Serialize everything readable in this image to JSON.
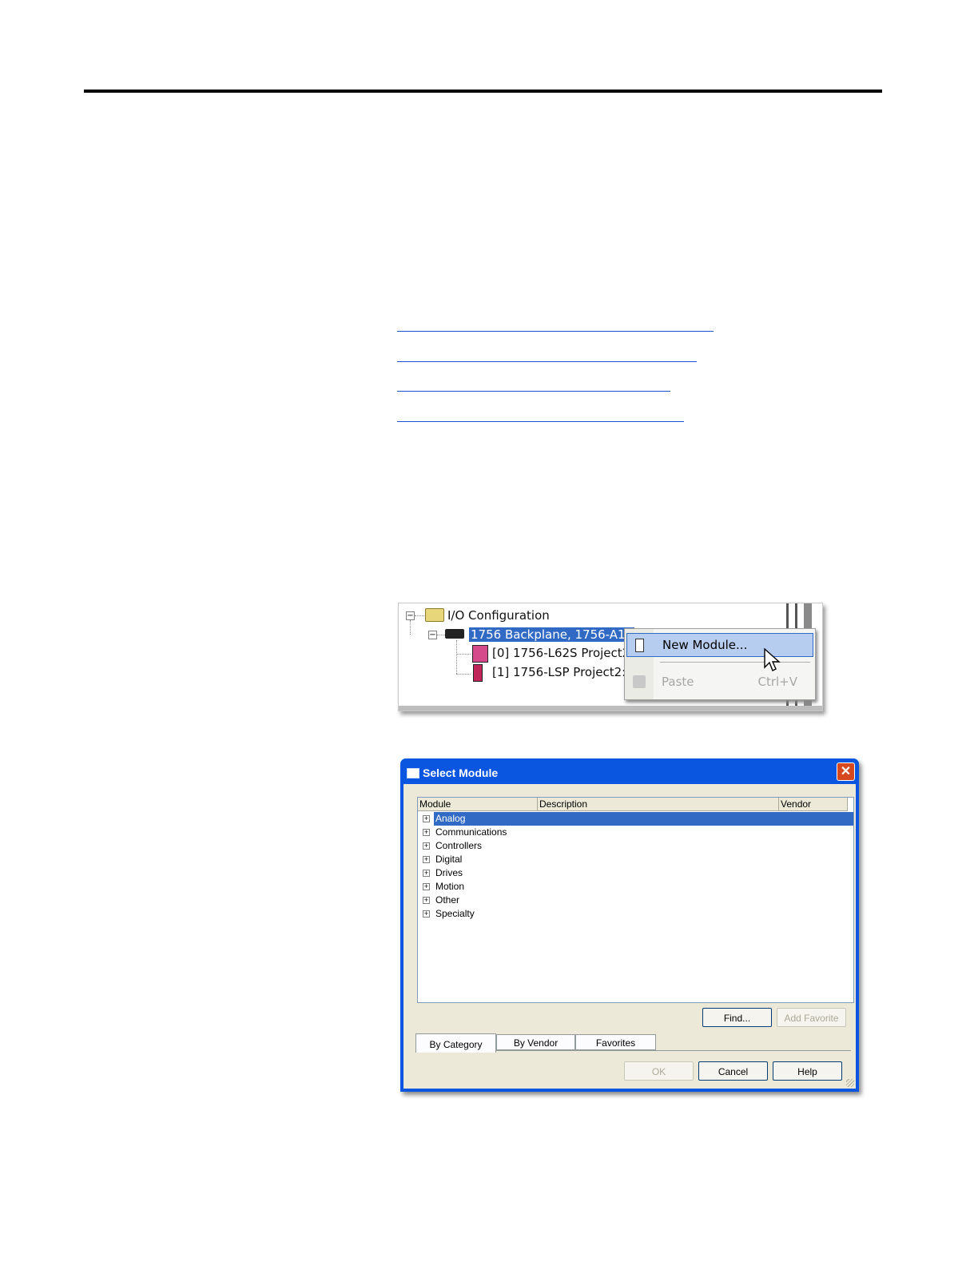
{
  "tree": {
    "root_label": "I/O Configuration",
    "backplane_label": "1756 Backplane, 1756-A10",
    "children": [
      {
        "label": "[0] 1756-L62S Project2"
      },
      {
        "label": "[1] 1756-LSP Project2:"
      }
    ]
  },
  "context_menu": {
    "items": [
      {
        "label": "New Module...",
        "shortcut": "",
        "enabled": true,
        "highlighted": true
      },
      {
        "label": "Paste",
        "shortcut": "Ctrl+V",
        "enabled": false,
        "highlighted": false
      }
    ]
  },
  "dialog": {
    "title": "Select Module",
    "columns": [
      "Module",
      "Description",
      "Vendor"
    ],
    "categories": [
      "Analog",
      "Communications",
      "Controllers",
      "Digital",
      "Drives",
      "Motion",
      "Other",
      "Specialty"
    ],
    "selected_category": "Analog",
    "find_label": "Find...",
    "add_favorite_label": "Add Favorite",
    "tabs": [
      "By Category",
      "By Vendor",
      "Favorites"
    ],
    "active_tab": "By Category",
    "ok_label": "OK",
    "cancel_label": "Cancel",
    "help_label": "Help"
  },
  "colors": {
    "selection": "#316ac5",
    "title_bar": "#0b56e0",
    "dialog_face": "#ece9d8",
    "link": "#1a4fd6"
  }
}
